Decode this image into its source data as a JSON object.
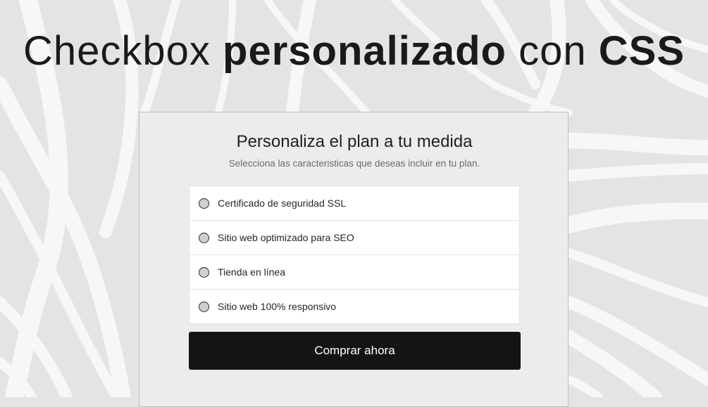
{
  "headline": {
    "part1": "Checkbox ",
    "part2": "personalizado",
    "part3": " con ",
    "part4": "CSS"
  },
  "card": {
    "title": "Personaliza el plan a tu medida",
    "subtitle": "Selecciona las caracteristicas que deseas incluir en tu plan.",
    "options": [
      {
        "label": "Certificado de seguridad SSL",
        "checked": false
      },
      {
        "label": "Sitio web optimizado para SEO",
        "checked": false
      },
      {
        "label": "Tienda en línea",
        "checked": false
      },
      {
        "label": "Sitio web 100% responsivo",
        "checked": false
      }
    ],
    "button_label": "Comprar ahora"
  },
  "colors": {
    "background": "#e4e4e4",
    "card": "#ececec",
    "button": "#141414",
    "wave": "#f7f7f7"
  }
}
